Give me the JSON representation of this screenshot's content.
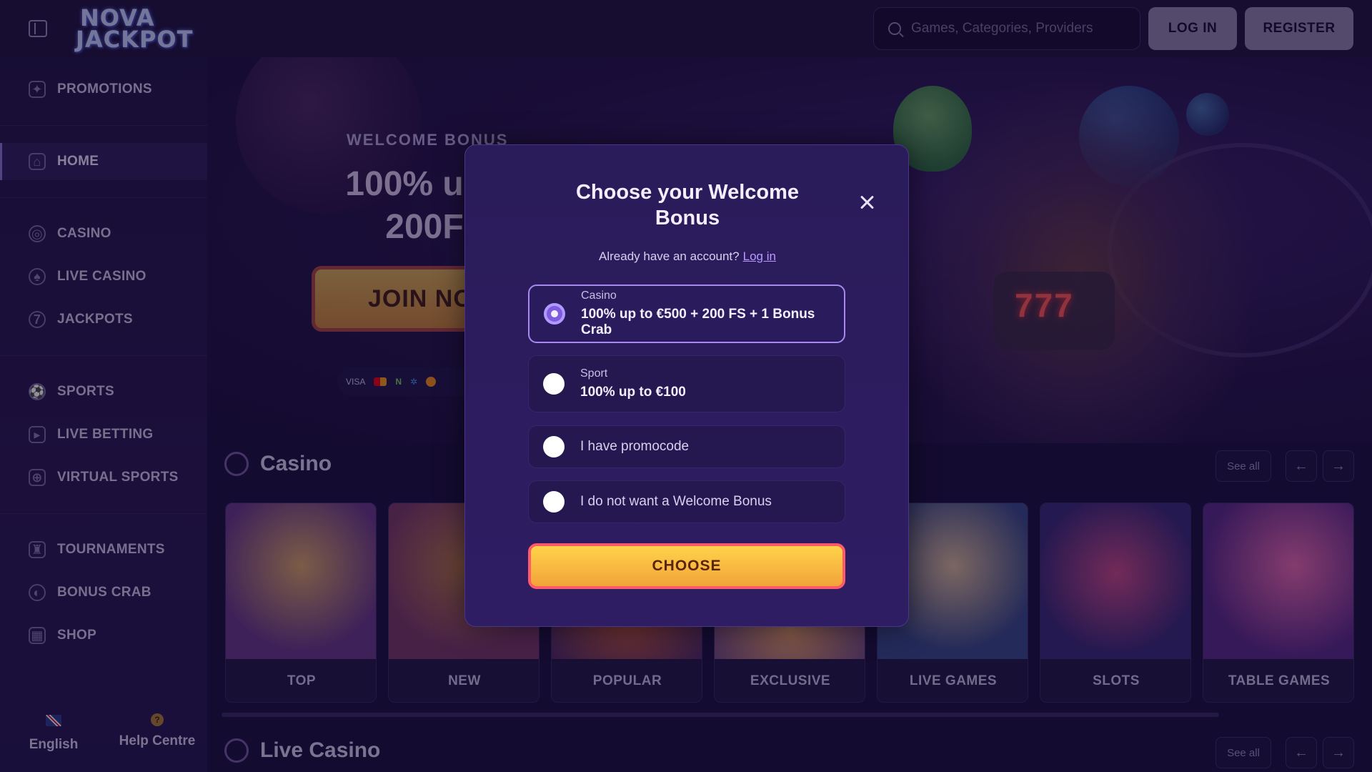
{
  "header": {
    "logo_line1": "NOVA",
    "logo_line2": "JACKPOT",
    "search_placeholder": "Games, Categories, Providers",
    "login_label": "LOG IN",
    "register_label": "REGISTER"
  },
  "sidebar": {
    "items": [
      {
        "label": "PROMOTIONS",
        "icon": "gift-icon"
      },
      {
        "label": "HOME",
        "icon": "home-icon",
        "active": true
      },
      {
        "label": "CASINO",
        "icon": "chip-icon"
      },
      {
        "label": "LIVE CASINO",
        "icon": "spade-icon"
      },
      {
        "label": "JACKPOTS",
        "icon": "seven-icon"
      },
      {
        "label": "SPORTS",
        "icon": "ball-icon"
      },
      {
        "label": "LIVE BETTING",
        "icon": "play-icon"
      },
      {
        "label": "VIRTUAL SPORTS",
        "icon": "gamepad-icon"
      },
      {
        "label": "TOURNAMENTS",
        "icon": "trophy-icon"
      },
      {
        "label": "BONUS CRAB",
        "icon": "crab-icon"
      },
      {
        "label": "SHOP",
        "icon": "shop-icon"
      }
    ],
    "language": "English",
    "help": "Help Centre"
  },
  "hero": {
    "kicker": "WELCOME BONUS",
    "title_line1": "100% up to",
    "title_line2": "200FS",
    "join_label": "JOIN NO",
    "payments": [
      "VISA",
      "Mastercard",
      "N",
      "Ripple",
      "Bitcoin"
    ]
  },
  "casino_section": {
    "title": "Casino",
    "see_all": "See all",
    "categories": [
      "TOP",
      "NEW",
      "POPULAR",
      "EXCLUSIVE",
      "LIVE GAMES",
      "SLOTS",
      "TABLE GAMES"
    ]
  },
  "live_casino_section": {
    "title": "Live Casino",
    "see_all": "See all"
  },
  "modal": {
    "title_line1": "Choose your Welcome",
    "title_line2": "Bonus",
    "subtitle": "Already have an account?",
    "login_link": "Log in",
    "options": [
      {
        "kicker": "Casino",
        "main": "100% up to €500 + 200 FS + 1 Bonus Crab",
        "selected": true
      },
      {
        "kicker": "Sport",
        "main": "100% up to €100",
        "selected": false
      },
      {
        "label": "I have promocode",
        "selected": false
      },
      {
        "label": "I do not want a Welcome Bonus",
        "selected": false
      }
    ],
    "choose_label": "CHOOSE"
  }
}
